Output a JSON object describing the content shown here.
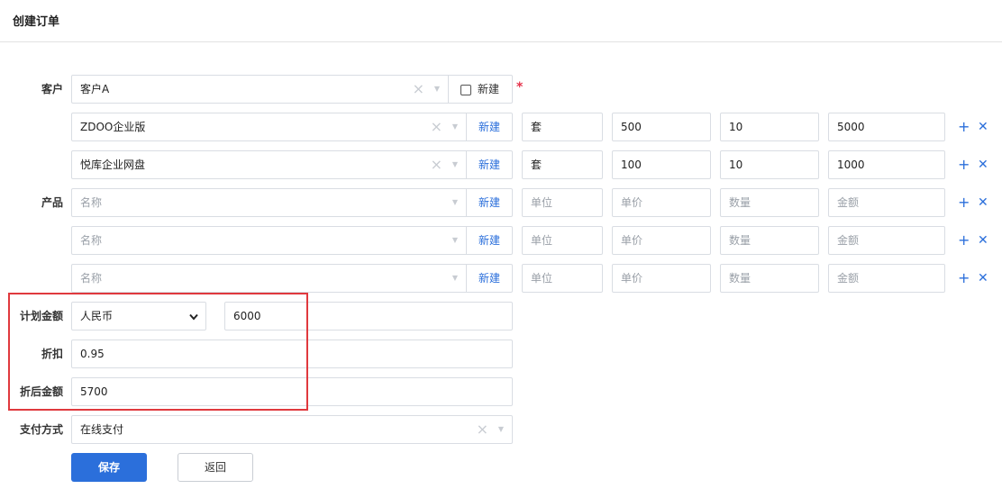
{
  "page": {
    "title": "创建订单"
  },
  "customer": {
    "label": "客户",
    "value": "客户A",
    "new_label": "新建",
    "required_mark": "*"
  },
  "product": {
    "label": "产品",
    "new_label": "新建",
    "rows": [
      {
        "name": "ZDOO企业版",
        "unit": "套",
        "price": "500",
        "qty": "10",
        "amount": "5000"
      },
      {
        "name": "悦库企业网盘",
        "unit": "套",
        "price": "100",
        "qty": "10",
        "amount": "1000"
      },
      {
        "name": "",
        "unit": "",
        "price": "",
        "qty": "",
        "amount": ""
      },
      {
        "name": "",
        "unit": "",
        "price": "",
        "qty": "",
        "amount": ""
      },
      {
        "name": "",
        "unit": "",
        "price": "",
        "qty": "",
        "amount": ""
      }
    ],
    "placeholders": {
      "name": "名称",
      "unit": "单位",
      "price": "单价",
      "qty": "数量",
      "amount": "金额"
    },
    "add_icon": "plus-icon",
    "remove_icon": "times-icon"
  },
  "plan_amount": {
    "label": "计划金额",
    "currency": "人民币",
    "value": "6000"
  },
  "discount": {
    "label": "折扣",
    "value": "0.95"
  },
  "final_amount": {
    "label": "折后金额",
    "value": "5700"
  },
  "payment": {
    "label": "支付方式",
    "value": "在线支付"
  },
  "actions": {
    "save_label": "保存",
    "back_label": "返回"
  },
  "colors": {
    "accent": "#2b6fdb",
    "highlight": "#e0393e",
    "required": "#e5334b"
  }
}
